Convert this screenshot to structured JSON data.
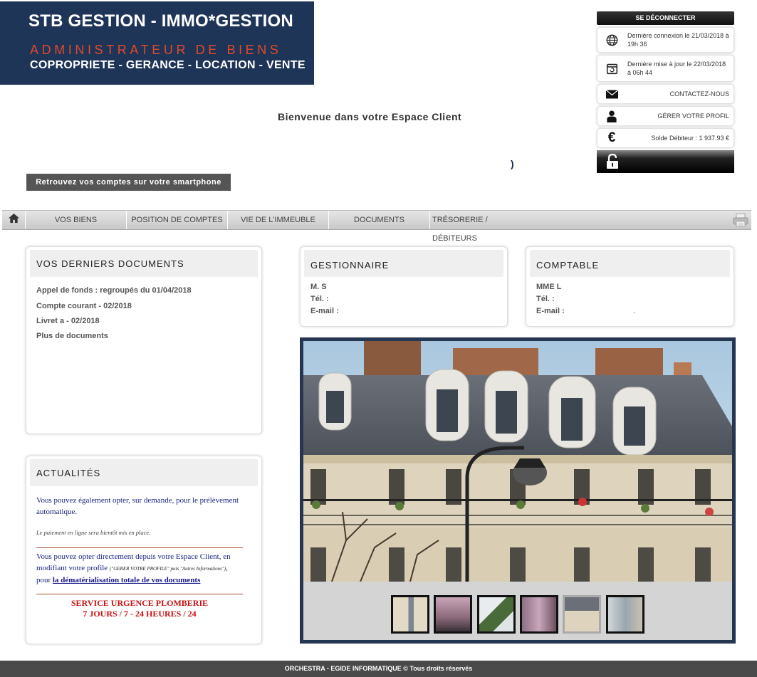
{
  "logo": {
    "line1": "STB GESTION - IMMO*GESTION",
    "line2": "ADMINISTRATEUR DE BIENS",
    "line3": "COPROPRIETE - GERANCE - LOCATION - VENTE"
  },
  "welcome": "Bienvenue dans votre Espace Client",
  "paren": ")",
  "smartphone_button": "Retrouvez vos comptes sur votre smartphone",
  "account_panel": {
    "logout": "SE DÉCONNECTER",
    "last_login": "Dernière connexion le 21/03/2018 à 19h 36",
    "last_update": "Dernière mise à jour le 22/03/2018 à 06h 44",
    "contact": "CONTACTEZ-NOUS",
    "profile": "GÉRER VOTRE PROFIL",
    "balance": "Solde Débiteur : 1 937.93 €",
    "icons": [
      "globe-icon",
      "calendar-refresh-icon",
      "envelope-icon",
      "user-icon",
      "euro-icon",
      "lock-icon"
    ]
  },
  "nav": {
    "items": [
      "VOS BIENS",
      "POSITION DE COMPTES",
      "VIE DE L'IMMEUBLE",
      "DOCUMENTS",
      "TRÉSORERIE / DÉBITEURS"
    ]
  },
  "documents": {
    "title": "VOS DERNIERS DOCUMENTS",
    "items": [
      "Appel de fonds : regroupés du 01/04/2018",
      "Compte courant - 02/2018",
      "Livret a - 02/2018"
    ],
    "more": "Plus de documents"
  },
  "manager": {
    "title": "GESTIONNAIRE",
    "name": "M. S",
    "tel": "Tél. :",
    "email": "E-mail :"
  },
  "accountant": {
    "title": "COMPTABLE",
    "name": "MME L",
    "tel": "Tél. :",
    "email": "E-mail :",
    "dot": "."
  },
  "news": {
    "title": "ACTUALITÉS",
    "p1": "Vous pouvez également opter, sur demande, pour le prélèvement automatique.",
    "p2": "Le paiement en ligne sera bientôt mis en place.",
    "p3a": "Vous pouvez opter directement depuis votre Espace Client, en modifiant votre profile ",
    "p3b": "(\"GERER VOTRE PROFILE\" puis \"Autres Informations\")",
    "p3c": ", pour ",
    "p3link": "la dématérialisation totale de vos documents",
    "urgent1": "SERVICE URGENCE PLOMBERIE",
    "urgent2": "7 JOURS / 7 - 24 HEURES / 24"
  },
  "footer": "ORCHESTRA - EGIDE INFORMATIQUE © Tous droits réservés",
  "colors": {
    "logo_bg": "#1f3558",
    "logo_accent": "#e0482a",
    "frame": "#243650",
    "news_text": "#1a237e",
    "urgent": "#c81010"
  }
}
